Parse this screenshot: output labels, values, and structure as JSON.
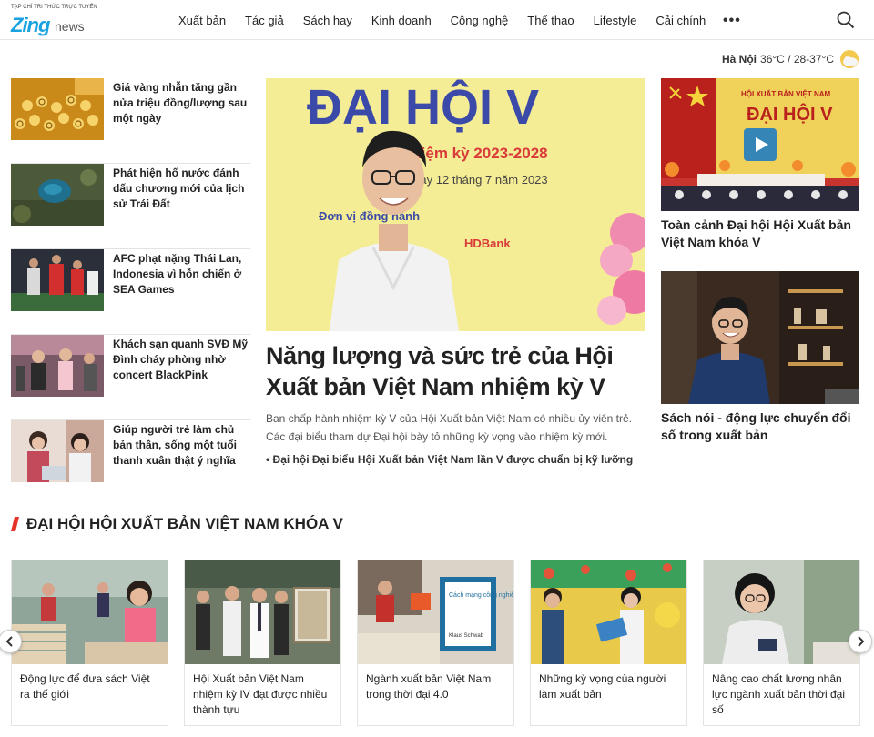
{
  "header": {
    "logo_tagline": "TẠP CHÍ TRI THỨC TRỰC TUYẾN",
    "logo_main": "Zing",
    "logo_suffix": "news",
    "nav": [
      "Xuất bản",
      "Tác giả",
      "Sách hay",
      "Kinh doanh",
      "Công nghệ",
      "Thể thao",
      "Lifestyle",
      "Cải chính"
    ],
    "more": "•••"
  },
  "weather": {
    "city": "Hà Nội",
    "temp": "36°C / 28-37°C"
  },
  "left_list": [
    {
      "title": "Giá vàng nhẫn tăng gần nửa triệu đồng/lượng sau một ngày"
    },
    {
      "title": "Phát hiện hố nước đánh dấu chương mới của lịch sử Trái Đất"
    },
    {
      "title": "AFC phạt nặng Thái Lan, Indonesia vì hỗn chiến ở SEA Games"
    },
    {
      "title": "Khách sạn quanh SVĐ Mỹ Đình cháy phòng nhờ concert BlackPink"
    },
    {
      "title": "Giúp người trẻ làm chủ bản thân, sống một tuổi thanh xuân thật ý nghĩa"
    }
  ],
  "hero": {
    "banner_big": "ĐẠI HỘI V",
    "banner_term": "Nhiệm kỳ 2023-2028",
    "banner_date": "Hà Nội, ngày 12 tháng 7 năm 2023",
    "banner_unit": "Đơn vị đồng hành",
    "banner_sponsor": "HDBank",
    "title": "Năng lượng và sức trẻ của Hội Xuất bản Việt Nam nhiệm kỳ V",
    "sapo": "Ban chấp hành nhiệm kỳ V của Hội Xuất bản Việt Nam có nhiều ủy viên trẻ. Các đại biểu tham dự Đại hội bày tỏ những kỳ vọng vào nhiệm kỳ mới.",
    "related": "• Đại hội Đại biểu Hội Xuất bản Việt Nam lần V được chuẩn bị kỹ lưỡng"
  },
  "right": [
    {
      "title": "Toàn cảnh Đại hội Hội Xuất bản Việt Nam khóa V",
      "banner_small": "HỘI XUẤT BẢN VIỆT NAM",
      "banner_big": "ĐẠI HỘI V"
    },
    {
      "title": "Sách nói - động lực chuyển đổi số trong xuất bản"
    }
  ],
  "section": {
    "title": "ĐẠI HỘI HỘI XUẤT BẢN VIỆT NAM KHÓA V",
    "cards": [
      {
        "title": "Động lực để đưa sách Việt ra thế giới"
      },
      {
        "title": "Hội Xuất bản Việt Nam nhiệm kỳ IV đạt được nhiều thành tựu"
      },
      {
        "title": "Ngành xuất bản Việt Nam trong thời đại 4.0",
        "book_text": "Cách mạng công nghiệp lần thứ tư",
        "book_author": "Klaus Schwab"
      },
      {
        "title": "Những kỳ vọng của người làm xuất bản"
      },
      {
        "title": "Nâng cao chất lượng nhân lực ngành xuất bản thời đại số"
      }
    ]
  },
  "colors": {
    "accent": "#e63329",
    "brand": "#1aa2e0"
  },
  "icons": {
    "search": "search-icon",
    "weather": "partly-cloudy-icon",
    "play": "play-icon",
    "prev": "chevron-left-icon",
    "next": "chevron-right-icon"
  }
}
